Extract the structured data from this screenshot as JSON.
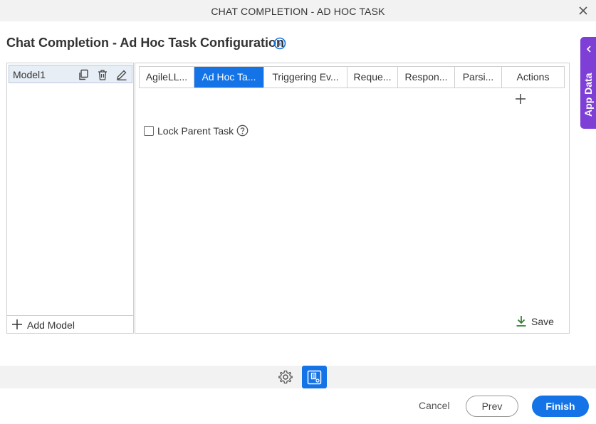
{
  "window": {
    "title": "CHAT COMPLETION - AD HOC TASK"
  },
  "heading": "Chat Completion - Ad Hoc Task Configuration",
  "app_data_tab": {
    "label": "App Data"
  },
  "models": {
    "items": [
      {
        "name": "Model1"
      }
    ],
    "add_label": "Add Model"
  },
  "tabs": [
    {
      "label": "AgileLL...",
      "active": false
    },
    {
      "label": "Ad Hoc Ta...",
      "active": true
    },
    {
      "label": "Triggering Ev...",
      "active": false
    },
    {
      "label": "Reque...",
      "active": false
    },
    {
      "label": "Respon...",
      "active": false
    },
    {
      "label": "Parsi...",
      "active": false
    },
    {
      "label": "Actions",
      "active": false
    }
  ],
  "form": {
    "lock_parent_task_label": "Lock Parent Task",
    "lock_parent_task_checked": false
  },
  "save_label": "Save",
  "footer": {
    "cancel_label": "Cancel",
    "prev_label": "Prev",
    "finish_label": "Finish"
  },
  "colors": {
    "primary": "#1473e6",
    "app_data_purple": "#7e3fd6",
    "save_green": "#2e7d32",
    "info_blue": "#1473e6"
  }
}
